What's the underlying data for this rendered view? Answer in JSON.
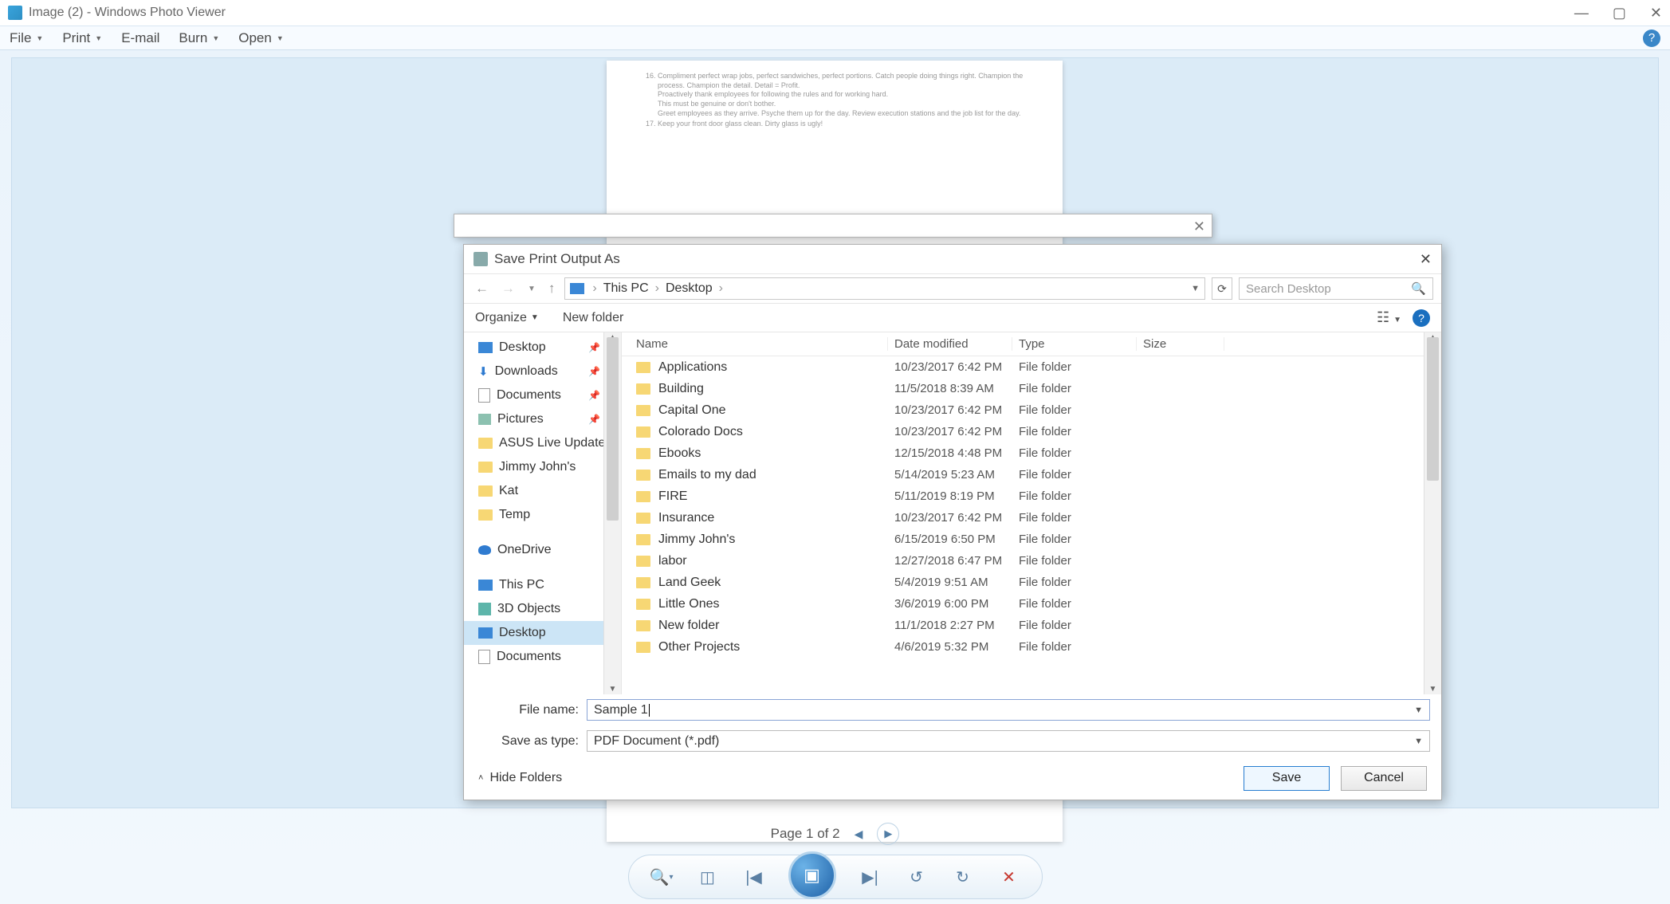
{
  "window": {
    "title": "Image (2) - Windows Photo Viewer"
  },
  "menu": {
    "file": "File",
    "print": "Print",
    "email": "E-mail",
    "burn": "Burn",
    "open": "Open"
  },
  "doc_lines": [
    "Compliment perfect wrap jobs, perfect sandwiches, perfect portions. Catch people doing things right. Champion the process. Champion the detail. Detail = Profit.",
    "Proactively thank employees for following the rules and for working hard.",
    "This must be genuine or don't bother.",
    "Greet employees as they arrive. Psyche them up for the day. Review execution stations and the job list for the day.",
    "Keep your front door glass clean. Dirty glass is ugly!"
  ],
  "save_dialog": {
    "title": "Save Print Output As",
    "breadcrumb": {
      "root": "This PC",
      "folder": "Desktop"
    },
    "search_placeholder": "Search Desktop",
    "organize": "Organize",
    "new_folder": "New folder",
    "headers": {
      "name": "Name",
      "date": "Date modified",
      "type": "Type",
      "size": "Size"
    },
    "tree": [
      {
        "label": "Desktop",
        "icon": "desktop",
        "pinned": true
      },
      {
        "label": "Downloads",
        "icon": "dl",
        "pinned": true
      },
      {
        "label": "Documents",
        "icon": "doc",
        "pinned": true
      },
      {
        "label": "Pictures",
        "icon": "pic",
        "pinned": true
      },
      {
        "label": "ASUS Live Update",
        "icon": "folder"
      },
      {
        "label": "Jimmy John's",
        "icon": "folder"
      },
      {
        "label": "Kat",
        "icon": "folder"
      },
      {
        "label": "Temp",
        "icon": "folder"
      },
      {
        "label": "OneDrive",
        "icon": "od",
        "spacer": true
      },
      {
        "label": "This PC",
        "icon": "pc",
        "spacer": true
      },
      {
        "label": "3D Objects",
        "icon": "3d"
      },
      {
        "label": "Desktop",
        "icon": "desktop",
        "selected": true
      },
      {
        "label": "Documents",
        "icon": "doc"
      }
    ],
    "files": [
      {
        "name": "Applications",
        "date": "10/23/2017 6:42 PM",
        "type": "File folder"
      },
      {
        "name": "Building",
        "date": "11/5/2018 8:39 AM",
        "type": "File folder"
      },
      {
        "name": "Capital One",
        "date": "10/23/2017 6:42 PM",
        "type": "File folder"
      },
      {
        "name": "Colorado Docs",
        "date": "10/23/2017 6:42 PM",
        "type": "File folder"
      },
      {
        "name": "Ebooks",
        "date": "12/15/2018 4:48 PM",
        "type": "File folder"
      },
      {
        "name": "Emails to my dad",
        "date": "5/14/2019 5:23 AM",
        "type": "File folder"
      },
      {
        "name": "FIRE",
        "date": "5/11/2019 8:19 PM",
        "type": "File folder"
      },
      {
        "name": "Insurance",
        "date": "10/23/2017 6:42 PM",
        "type": "File folder"
      },
      {
        "name": "Jimmy John's",
        "date": "6/15/2019 6:50 PM",
        "type": "File folder"
      },
      {
        "name": "labor",
        "date": "12/27/2018 6:47 PM",
        "type": "File folder"
      },
      {
        "name": "Land Geek",
        "date": "5/4/2019 9:51 AM",
        "type": "File folder"
      },
      {
        "name": "Little Ones",
        "date": "3/6/2019 6:00 PM",
        "type": "File folder"
      },
      {
        "name": "New folder",
        "date": "11/1/2018 2:27 PM",
        "type": "File folder"
      },
      {
        "name": "Other Projects",
        "date": "4/6/2019 5:32 PM",
        "type": "File folder"
      }
    ],
    "file_name_label": "File name:",
    "file_name_value": "Sample 1",
    "save_type_label": "Save as type:",
    "save_type_value": "PDF Document (*.pdf)",
    "hide_folders": "Hide Folders",
    "save": "Save",
    "cancel": "Cancel"
  },
  "pager": {
    "text": "Page 1 of 2"
  }
}
